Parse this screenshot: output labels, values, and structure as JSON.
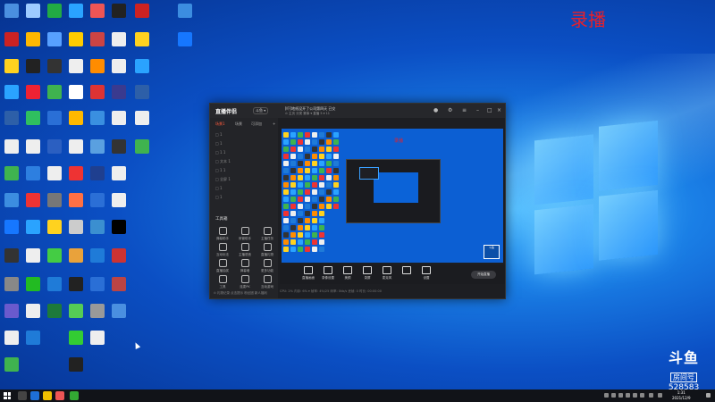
{
  "overlay": {
    "recording_label": "录播"
  },
  "desktop": {
    "icons": [
      {
        "label": "",
        "color": "#4a8fe0"
      },
      {
        "label": "",
        "color": "#c22"
      },
      {
        "label": "",
        "color": "#ffd21f"
      },
      {
        "label": "",
        "color": "#2aa3ff"
      },
      {
        "label": "",
        "color": "#2d5fa8"
      },
      {
        "label": "",
        "color": "#eee"
      },
      {
        "label": "",
        "color": "#3fb34f"
      },
      {
        "label": "",
        "color": "#3c8de0"
      },
      {
        "label": "",
        "color": "#1677ff"
      },
      {
        "label": "",
        "color": "#333"
      },
      {
        "label": "",
        "color": "#888"
      },
      {
        "label": "",
        "color": "#6a5acd"
      },
      {
        "label": "",
        "color": "#eee"
      },
      {
        "label": "",
        "color": "#3fb34f"
      },
      {
        "label": "",
        "color": "#9ecbff"
      },
      {
        "label": "",
        "color": "#ffb800"
      },
      {
        "label": "",
        "color": "#222"
      },
      {
        "label": "",
        "color": "#e23"
      },
      {
        "label": "",
        "color": "#2fbf5f"
      },
      {
        "label": "",
        "color": "#eee"
      },
      {
        "label": "",
        "color": "#2d7fe0"
      },
      {
        "label": "",
        "color": "#e33"
      },
      {
        "label": "",
        "color": "#2aa3ff"
      },
      {
        "label": "",
        "color": "#eee"
      },
      {
        "label": "",
        "color": "#2b2"
      },
      {
        "label": "",
        "color": "#eee"
      },
      {
        "label": "",
        "color": "#1f7bd8"
      },
      {
        "label": "",
        "color": "#2a4"
      },
      {
        "label": "",
        "color": "#57a0ff"
      },
      {
        "label": "",
        "color": "#333"
      },
      {
        "label": "",
        "color": "#3fb34f"
      },
      {
        "label": "",
        "color": "#2a6fd6"
      },
      {
        "label": "",
        "color": "#2b5fc1"
      },
      {
        "label": "",
        "color": "#eee"
      },
      {
        "label": "",
        "color": "#777"
      },
      {
        "label": "",
        "color": "#ffd21f"
      },
      {
        "label": "",
        "color": "#4c4"
      },
      {
        "label": "",
        "color": "#1f7bd8"
      },
      {
        "label": "",
        "color": "#1d7a3a"
      },
      {
        "label": "",
        "color": "#2aa3ff"
      },
      {
        "label": "",
        "color": "#ffcc00"
      },
      {
        "label": "",
        "color": "#eee"
      },
      {
        "label": "",
        "color": "#fff"
      },
      {
        "label": "",
        "color": "#ffb800"
      },
      {
        "label": "",
        "color": "#eee"
      },
      {
        "label": "",
        "color": "#e33"
      },
      {
        "label": "",
        "color": "#ff7043"
      },
      {
        "label": "",
        "color": "#ccc"
      },
      {
        "label": "",
        "color": "#e9a23b"
      },
      {
        "label": "",
        "color": "#222"
      },
      {
        "label": "",
        "color": "#5c5"
      },
      {
        "label": "",
        "color": "#3c3"
      },
      {
        "label": "",
        "color": "#222"
      },
      {
        "label": "",
        "color": "#e55"
      },
      {
        "label": "",
        "color": "#c44"
      },
      {
        "label": "",
        "color": "#ff8c00"
      },
      {
        "label": "",
        "color": "#d33"
      },
      {
        "label": "",
        "color": "#3a8fe0"
      },
      {
        "label": "",
        "color": "#5aa0e0"
      },
      {
        "label": "",
        "color": "#1f3f8f"
      },
      {
        "label": "",
        "color": "#2b6fd6"
      },
      {
        "label": "",
        "color": "#3b8fd0"
      },
      {
        "label": "",
        "color": "#1f7bd8"
      },
      {
        "label": "",
        "color": "#2a6fd6"
      },
      {
        "label": "",
        "color": "#999"
      },
      {
        "label": "",
        "color": "#eee"
      },
      {
        "label": "",
        "color": "#222"
      },
      {
        "label": "",
        "color": "#eee"
      },
      {
        "label": "",
        "color": "#eee"
      },
      {
        "label": "",
        "color": "#3a3a8f"
      },
      {
        "label": "",
        "color": "#eee"
      },
      {
        "label": "",
        "color": "#333"
      },
      {
        "label": "",
        "color": "#eee"
      },
      {
        "label": "",
        "color": "#eee"
      },
      {
        "label": "",
        "color": "#000"
      },
      {
        "label": "",
        "color": "#c33"
      },
      {
        "label": "",
        "color": "#b44"
      }
    ]
  },
  "app": {
    "logo": "直播伴侣",
    "tag": "斗鱼 ▾",
    "title": "[吓]地纸没开了公司第四天 已交",
    "title_tag": "商城",
    "sub": "⊙ 主页 分类 赛事 ▾   直播 5 ▾ 11",
    "sidebar": {
      "tabs": [
        "场景1",
        "场景",
        "可添加"
      ],
      "rows": [
        "□ 1",
        "□ 1",
        "□ 1 1",
        "□ 文本 1",
        "□ 1 1",
        "□ 全屏 1",
        "□ 1",
        "□ 1"
      ],
      "tools_title": "工具箱",
      "tools": [
        "弹幕助手",
        "房管助手",
        "主播任务",
        "互动玩法",
        "主播语音",
        "直播礼物",
        "直播抽奖",
        "弹幕墙",
        "更多功能",
        "工具",
        "连麦PK",
        "互动游戏"
      ],
      "footer": "⊙ 礼物记录 点击提示 粉丝团 新人福利"
    },
    "preview": {
      "rec_label": "录播",
      "badge": "斗鱼"
    },
    "controls": [
      "直播画面",
      "录像设置",
      "美颜",
      "录屏",
      "麦克风",
      "",
      "设置"
    ],
    "start_button": "开始直播",
    "status": "CPU: 2%  内存: 6% ▾  帧率: 4%/25  码率: 0kb/s  丢帧: 0  时长: 00:00:00"
  },
  "room": {
    "logo": "斗鱼",
    "label": "房间号",
    "number": "528583"
  },
  "taskbar": {
    "time": "1:31",
    "date": "2021/12/9"
  }
}
